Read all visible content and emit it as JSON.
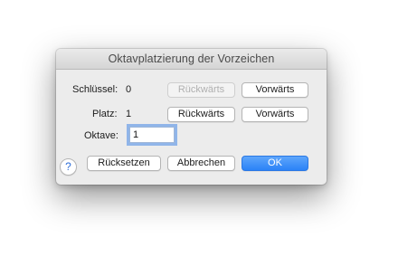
{
  "dialog": {
    "title": "Oktavplatzierung der Vorzeichen"
  },
  "rows": {
    "key": {
      "label": "Schlüssel:",
      "value": "0",
      "backward_label": "Rückwärts",
      "forward_label": "Vorwärts"
    },
    "place": {
      "label": "Platz:",
      "value": "1",
      "backward_label": "Rückwärts",
      "forward_label": "Vorwärts"
    },
    "octave": {
      "label": "Oktave:",
      "input_value": "1"
    }
  },
  "footer": {
    "help_label": "?",
    "reset_label": "Rücksetzen",
    "cancel_label": "Abbrechen",
    "ok_label": "OK"
  },
  "colors": {
    "accent": "#2b82f7",
    "window_bg": "#ececec"
  },
  "icons": {
    "help": "help-icon"
  }
}
